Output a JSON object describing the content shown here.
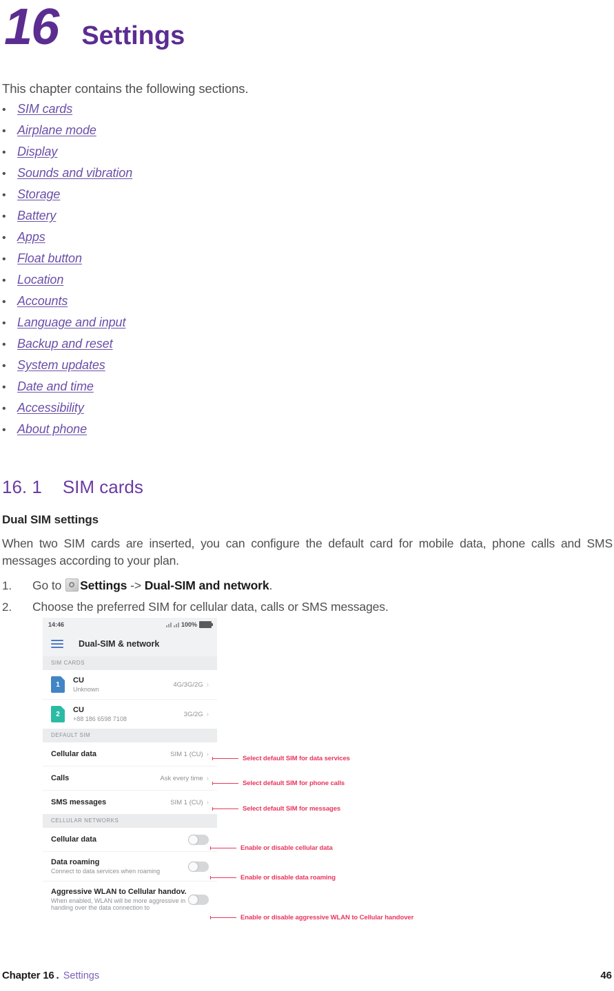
{
  "chapter": {
    "number": "16",
    "title": "Settings"
  },
  "intro": "This chapter contains the following sections.",
  "toc": {
    "bullet": "•",
    "items": [
      {
        "label": "SIM cards"
      },
      {
        "label": "Airplane mode"
      },
      {
        "label": "Display"
      },
      {
        "label": "Sounds and vibration"
      },
      {
        "label": "Storage"
      },
      {
        "label": "Battery"
      },
      {
        "label": "Apps"
      },
      {
        "label": "Float button"
      },
      {
        "label": "Location"
      },
      {
        "label": "Accounts"
      },
      {
        "label": "Language and input"
      },
      {
        "label": "Backup and reset"
      },
      {
        "label": "System updates"
      },
      {
        "label": "Date and time"
      },
      {
        "label": "Accessibility"
      },
      {
        "label": "About phone"
      }
    ]
  },
  "section": {
    "number": "16. 1",
    "name": "SIM cards",
    "sub_heading": "Dual SIM settings",
    "paragraph": "When two SIM cards are inserted, you can configure the default card for mobile data, phone calls and SMS messages according to your plan.",
    "steps": [
      {
        "num": "1.",
        "prefix": "Go to ",
        "icon": "settings-gear-icon",
        "bold1": "Settings",
        "mid": " -> ",
        "bold2": "Dual-SIM and network",
        "suffix": "."
      },
      {
        "num": "2.",
        "text": "Choose the preferred SIM for cellular data, calls or SMS messages."
      }
    ]
  },
  "screenshot": {
    "status": {
      "time": "14:46",
      "battery_percent": "100%"
    },
    "appbar": {
      "title": "Dual-SIM & network"
    },
    "sim_cards_label": "SIM CARDS",
    "sim_cards": [
      {
        "badge": "1",
        "name": "CU",
        "sub": "Unknown",
        "network": "4G/3G/2G"
      },
      {
        "badge": "2",
        "name": "CU",
        "sub": "+88 186 6598 7108",
        "network": "3G/2G"
      }
    ],
    "default_sim_label": "DEFAULT SIM",
    "default_sim_rows": [
      {
        "title": "Cellular data",
        "value": "SIM 1 (CU)"
      },
      {
        "title": "Calls",
        "value": "Ask every time"
      },
      {
        "title": "SMS messages",
        "value": "SIM 1 (CU)"
      }
    ],
    "cellular_networks_label": "CELLULAR NETWORKS",
    "network_rows": [
      {
        "title": "Cellular data",
        "sub": ""
      },
      {
        "title": "Data roaming",
        "sub": "Connect to data services when roaming"
      },
      {
        "title": "Aggressive WLAN to Cellular handov.",
        "sub": "When enabled, WLAN will be more aggressive in handing over the data connection to"
      }
    ]
  },
  "annotations": [
    {
      "text": "Select default SIM for data services"
    },
    {
      "text": "Select default SIM for phone calls"
    },
    {
      "text": "Select default SIM for messages"
    },
    {
      "text": "Enable or disable cellular data"
    },
    {
      "text": "Enable or disable data roaming"
    },
    {
      "text": "Enable or disable aggressive WLAN to Cellular handover"
    }
  ],
  "footer": {
    "chapter": "Chapter 16",
    "separator": ".",
    "section": "Settings",
    "page": "46"
  },
  "colors": {
    "brand_purple": "#5B2D91",
    "link_purple": "#6B4FA8",
    "annotation_red": "#E8365D",
    "sim1_blue": "#4285C5",
    "sim2_teal": "#2BBBA4"
  }
}
